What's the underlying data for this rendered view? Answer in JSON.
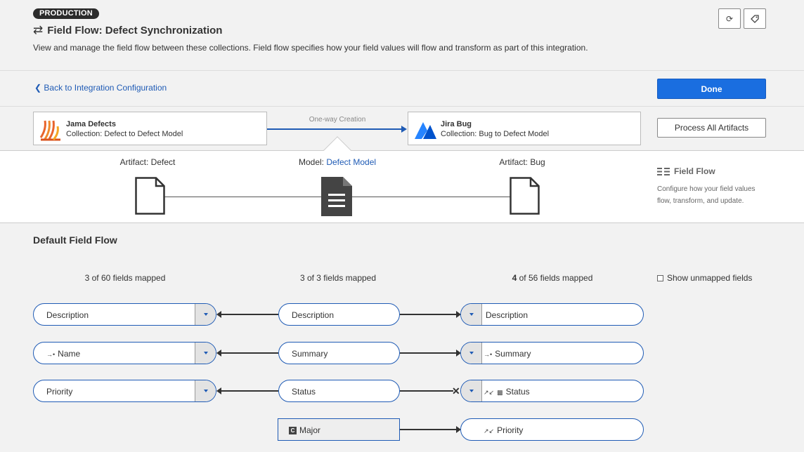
{
  "header": {
    "badge": "PRODUCTION",
    "title": "Field Flow: Defect Synchronization",
    "description": "View and manage the field flow between these collections. Field flow specifies how your field values will flow and transform as part of this integration."
  },
  "nav": {
    "back_label": "Back to Integration Configuration",
    "done_label": "Done"
  },
  "collections": {
    "left": {
      "name": "Jama Defects",
      "collection": "Collection: Defect to Defect Model"
    },
    "relation": "One-way Creation",
    "right": {
      "name": "Jira Bug",
      "collection": "Collection: Bug to Defect Model"
    },
    "process_label": "Process All Artifacts"
  },
  "artifacts": {
    "left_prefix": "Artifact: ",
    "left_name": "Defect",
    "model_prefix": "Model: ",
    "model_name": "Defect Model",
    "right_prefix": "Artifact: ",
    "right_name": "Bug"
  },
  "field_flow_panel": {
    "title": "Field Flow",
    "description": "Configure how your field values flow, transform, and update."
  },
  "default_flow": {
    "title": "Default Field Flow",
    "left_mapped": "3 of 60 fields mapped",
    "mid_mapped": "3 of 3 fields mapped",
    "right_mapped_count": "4",
    "right_mapped_rest": " of 56 fields mapped",
    "show_unmapped": "Show unmapped fields"
  },
  "rows": [
    {
      "left": "Description",
      "mid": "Description",
      "right": "Description"
    },
    {
      "left": "Name",
      "mid": "Summary",
      "right": "Summary"
    },
    {
      "left": "Priority",
      "mid": "Status",
      "right": "Status"
    },
    {
      "mid": "Major",
      "right": "Priority"
    }
  ],
  "colors": {
    "accent": "#1a6ee0",
    "link": "#1f5bb5",
    "jama_orange": "#e8642c",
    "jira_blue": "#2684ff"
  }
}
